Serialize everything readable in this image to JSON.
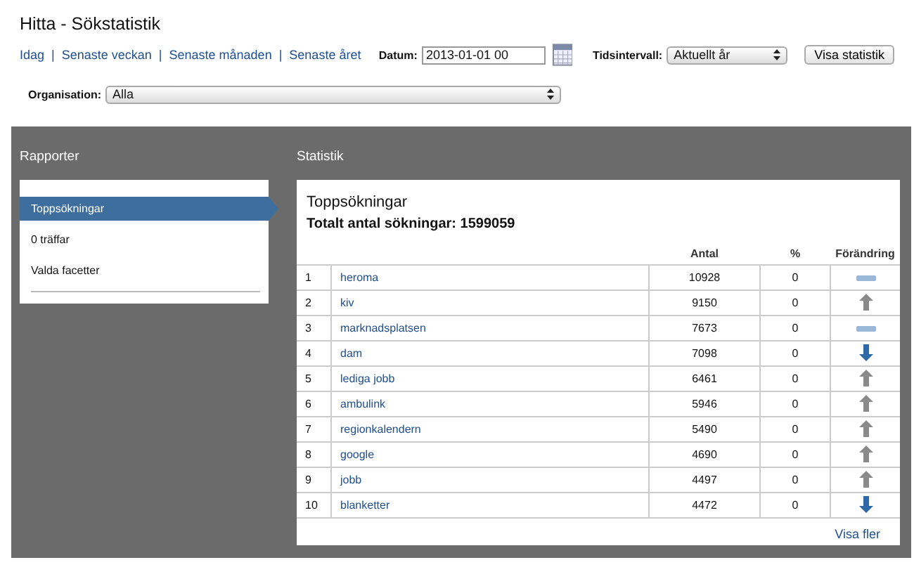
{
  "page_title": "Hitta - Sökstatistik",
  "quick_links": [
    "Idag",
    "Senaste veckan",
    "Senaste månaden",
    "Senaste året"
  ],
  "separator": "|",
  "date": {
    "label": "Datum:",
    "value": "2013-01-01 00"
  },
  "interval": {
    "label": "Tidsintervall:",
    "value": "Aktuellt år"
  },
  "show_button": "Visa statistik",
  "organisation": {
    "label": "Organisation:",
    "value": "Alla"
  },
  "reports": {
    "title": "Rapporter",
    "items": [
      {
        "label": "Toppsökningar",
        "selected": true
      },
      {
        "label": "0 träffar",
        "selected": false
      },
      {
        "label": "Valda facetter",
        "selected": false
      }
    ]
  },
  "statistics": {
    "title": "Statistik",
    "heading": "Toppsökningar",
    "total": "Totalt antal sökningar: 1599059",
    "columns": [
      "Antal",
      "%",
      "Förändring"
    ],
    "rows": [
      {
        "rank": "1",
        "term": "heroma",
        "count": "10928",
        "percent": "0",
        "kind": "same"
      },
      {
        "rank": "2",
        "term": "kiv",
        "count": "9150",
        "percent": "0",
        "kind": "up"
      },
      {
        "rank": "3",
        "term": "marknadsplatsen",
        "count": "7673",
        "percent": "0",
        "kind": "same"
      },
      {
        "rank": "4",
        "term": "dam",
        "count": "7098",
        "percent": "0",
        "kind": "down"
      },
      {
        "rank": "5",
        "term": "lediga jobb",
        "count": "6461",
        "percent": "0",
        "kind": "up"
      },
      {
        "rank": "6",
        "term": "ambulink",
        "count": "5946",
        "percent": "0",
        "kind": "up"
      },
      {
        "rank": "7",
        "term": "regionkalendern",
        "count": "5490",
        "percent": "0",
        "kind": "up"
      },
      {
        "rank": "8",
        "term": "google",
        "count": "4690",
        "percent": "0",
        "kind": "up"
      },
      {
        "rank": "9",
        "term": "jobb",
        "count": "4497",
        "percent": "0",
        "kind": "up"
      },
      {
        "rank": "10",
        "term": "blanketter",
        "count": "4472",
        "percent": "0",
        "kind": "down"
      }
    ],
    "more_link": "Visa fler"
  }
}
